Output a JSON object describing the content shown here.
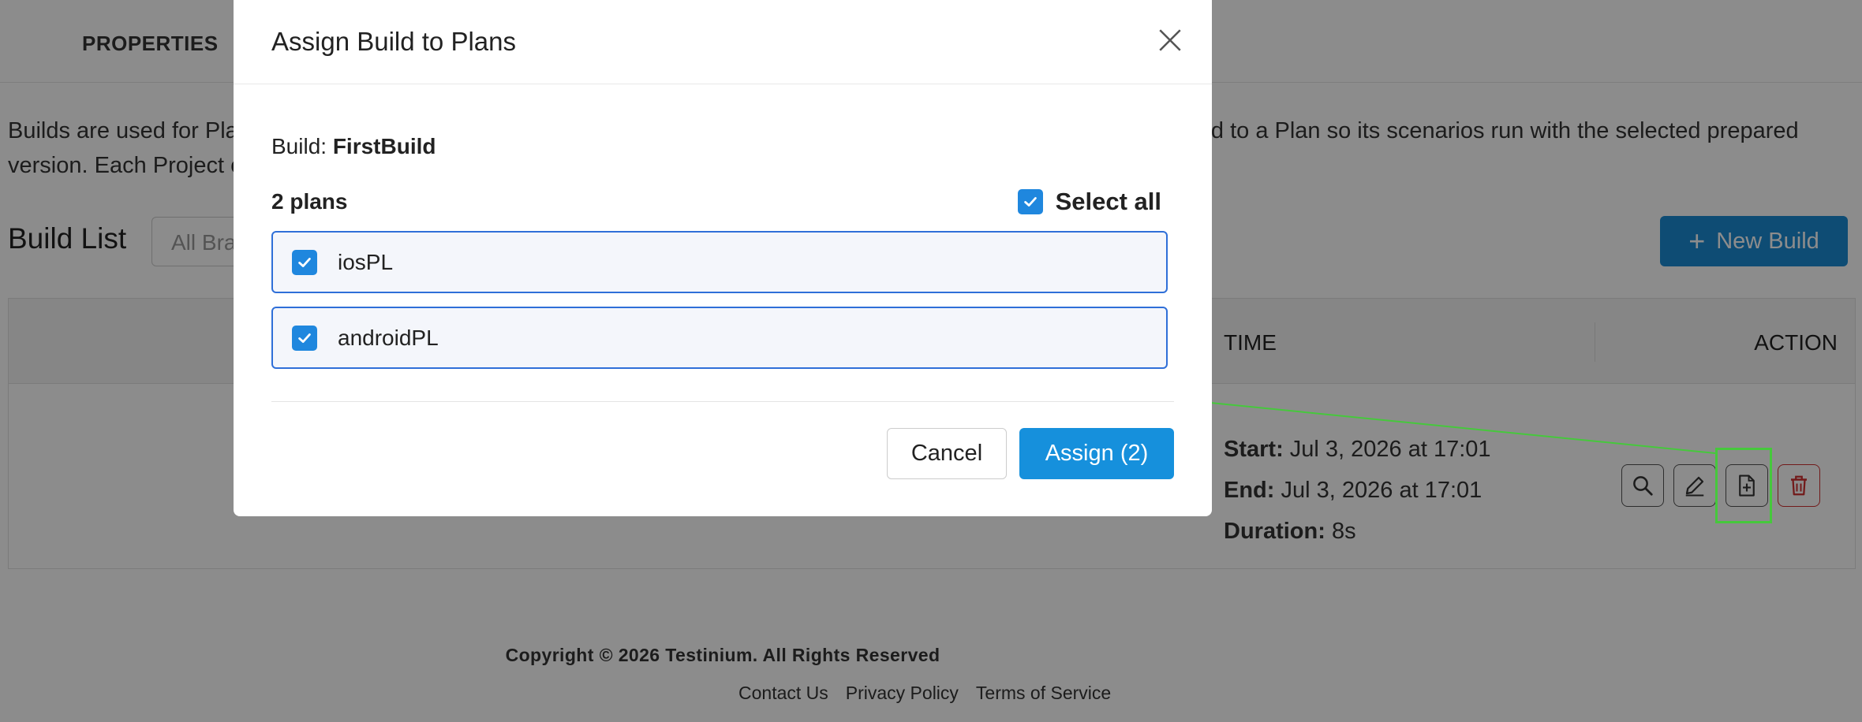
{
  "page": {
    "tab": "PROPERTIES",
    "description_line1": "Builds are used for Pla",
    "description_line1_end": "ild to a Plan so its scenarios run with the selected prepared",
    "description_line2": "version. Each Project c",
    "build_list_title": "Build List",
    "branch_placeholder": "All Bra",
    "new_build_label": "New Build",
    "table": {
      "col_time": "TIME",
      "col_action": "ACTION",
      "row": {
        "start_label": "Start:",
        "start_value": "Jul 3, 2026 at 17:01",
        "end_label": "End:",
        "end_value": "Jul 3, 2026 at 17:01",
        "duration_label": "Duration:",
        "duration_value": "8s"
      }
    },
    "footer": {
      "copyright": "Copyright © 2026 Testinium. All Rights Reserved",
      "links": [
        "Contact Us",
        "Privacy Policy",
        "Terms of Service"
      ]
    }
  },
  "modal": {
    "title": "Assign Build to Plans",
    "build_label": "Build:",
    "build_name": "FirstBuild",
    "plans_count": "2 plans",
    "select_all_label": "Select all",
    "select_all_checked": true,
    "plans": [
      {
        "name": "iosPL",
        "checked": true
      },
      {
        "name": "androidPL",
        "checked": true
      }
    ],
    "cancel_label": "Cancel",
    "assign_label": "Assign (2)"
  },
  "colors": {
    "primary": "#1690dc",
    "checkbox": "#1f87de",
    "plan_border": "#2f6fd8",
    "delete": "#d03030",
    "highlight": "#46c83c"
  }
}
